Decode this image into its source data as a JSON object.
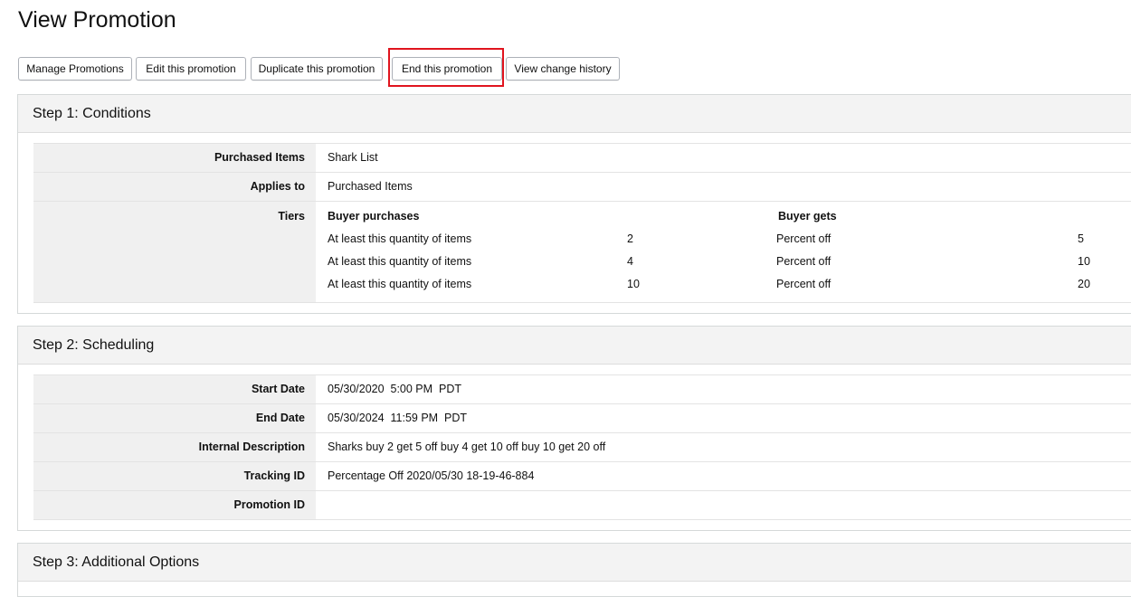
{
  "page": {
    "title": "View Promotion"
  },
  "toolbar": {
    "buttons": [
      "Manage Promotions",
      "Edit this promotion",
      "Duplicate this promotion",
      "End this promotion",
      "View change history"
    ]
  },
  "step1": {
    "title": "Step 1: Conditions",
    "purchased_items_label": "Purchased Items",
    "purchased_items_value": "Shark List",
    "applies_to_label": "Applies to",
    "applies_to_value": "Purchased Items",
    "tiers_label": "Tiers",
    "tiers_header_buyer_purchases": "Buyer purchases",
    "tiers_header_buyer_gets": "Buyer gets",
    "tiers": [
      {
        "condition": "At least this quantity of items",
        "quantity": "2",
        "benefit": "Percent off",
        "amount": "5"
      },
      {
        "condition": "At least this quantity of items",
        "quantity": "4",
        "benefit": "Percent off",
        "amount": "10"
      },
      {
        "condition": "At least this quantity of items",
        "quantity": "10",
        "benefit": "Percent off",
        "amount": "20"
      }
    ]
  },
  "step2": {
    "title": "Step 2: Scheduling",
    "start_date_label": "Start Date",
    "start_date_value": "05/30/2020  5:00 PM  PDT",
    "end_date_label": "End Date",
    "end_date_value": "05/30/2024  11:59 PM  PDT",
    "internal_description_label": "Internal Description",
    "internal_description_value": "Sharks buy 2 get 5 off buy 4 get 10 off buy 10 get 20 off",
    "tracking_id_label": "Tracking ID",
    "tracking_id_value": "Percentage Off 2020/05/30 18-19-46-884",
    "promotion_id_label": "Promotion ID",
    "promotion_id_value": ""
  },
  "step3": {
    "title": "Step 3: Additional Options"
  }
}
